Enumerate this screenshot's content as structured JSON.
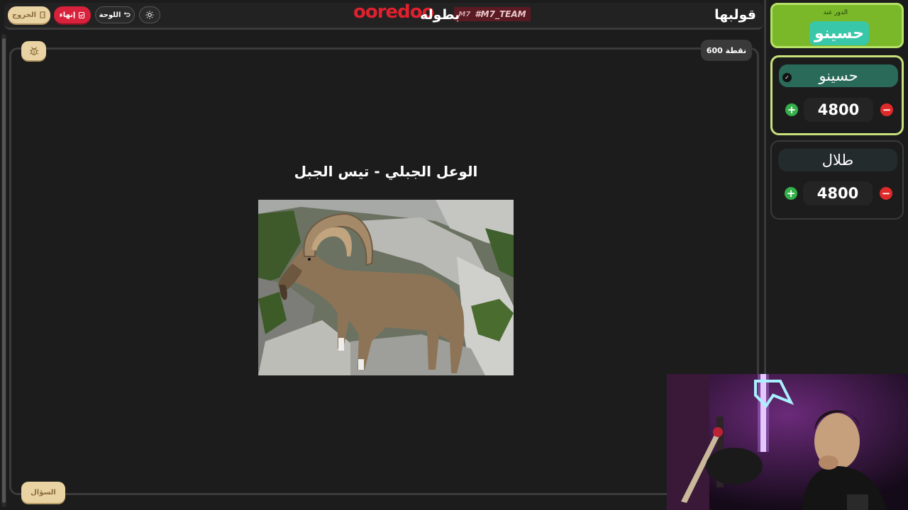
{
  "topbar": {
    "exit_label": "الخروج",
    "end_label": "إنهاء",
    "board_label": "اللوحة",
    "brand": "ooredoo",
    "tournament": "بطوله",
    "team_tag": "#M7_TEAM",
    "team_tag_prefix": "M7",
    "logo_title": "قولبها"
  },
  "question": {
    "points": "600 نقطة",
    "answer": "الوعل الجبلي - تيس الجبل",
    "question_button": "السؤال"
  },
  "turn": {
    "label": "الدور عند",
    "team": "حسينو"
  },
  "teams": [
    {
      "name": "حسينو",
      "score": "4800",
      "plus": "+",
      "minus": "−"
    },
    {
      "name": "طلال",
      "score": "4800",
      "plus": "+",
      "minus": "−"
    }
  ],
  "colors": {
    "accent_red": "#d8213a",
    "accent_green": "#7ab829",
    "active_border": "#c8e27c",
    "teal": "#38c7a8",
    "button_beige": "#e9d3a3"
  }
}
